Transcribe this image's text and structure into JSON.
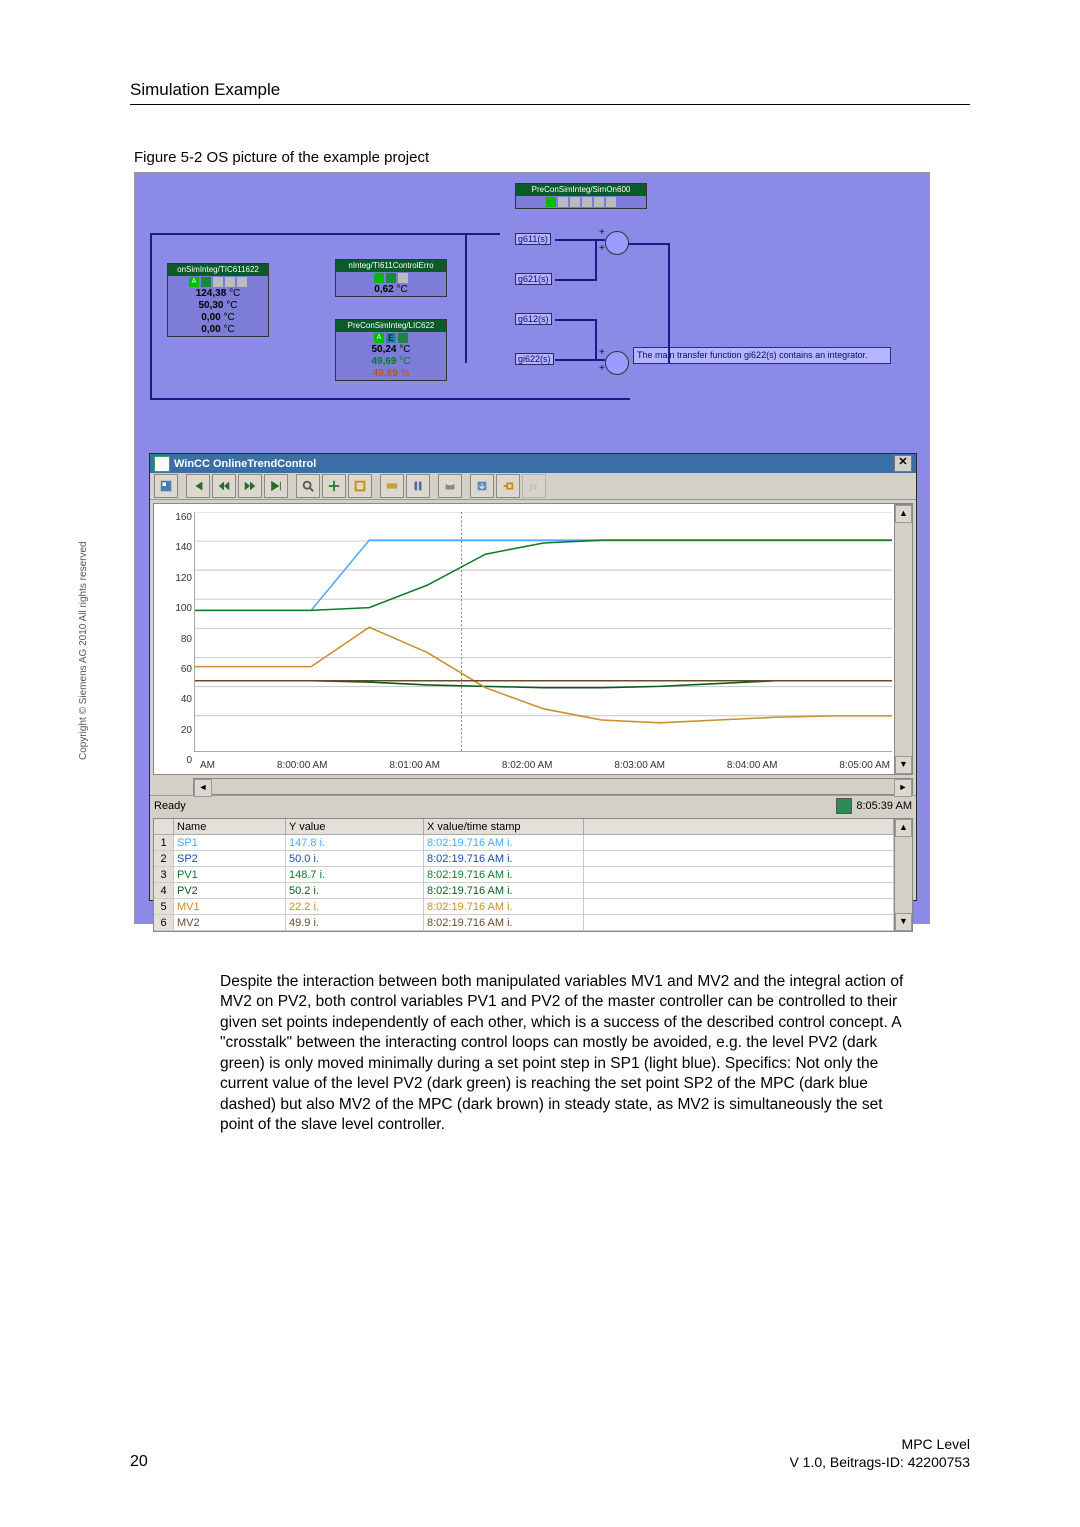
{
  "header": {
    "title": "Simulation Example"
  },
  "figure": {
    "caption": "Figure 5-2 OS picture of the example project"
  },
  "process": {
    "simon": {
      "title": "PreConSimInteg/SimOn600"
    },
    "tic": {
      "title": "onSimInteg/TIC611622",
      "v1": "124,38",
      "u1": "°C",
      "v2": "50,30",
      "u2": "°C",
      "v3": "0,00",
      "u3": "°C",
      "v4": "0,00",
      "u4": "°C"
    },
    "ctrlerr": {
      "title": "nInteg/TI611ControlErro",
      "v1": "0,62",
      "u1": "°C"
    },
    "lic": {
      "title": "PreConSimInteg/LIC622",
      "v1": "50,24",
      "u1": "°C",
      "v2": "49,69",
      "u2": "°C",
      "v3": "49,89",
      "u3": "%"
    },
    "tags": {
      "g611": "g611(s)",
      "g621": "g621(s)",
      "g612": "g612(s)",
      "gi622": "gi622(s)"
    },
    "note": "The main transfer function gi622(s) contains an integrator."
  },
  "trend": {
    "title": "WinCC OnlineTrendControl",
    "y_ticks": [
      "160",
      "140",
      "120",
      "100",
      "80",
      "60",
      "40",
      "20",
      "0"
    ],
    "x_ticks": [
      "AM",
      "8:00:00 AM",
      "8:01:00 AM",
      "8:02:00 AM",
      "8:03:00 AM",
      "8:04:00 AM",
      "8:05:00 AM"
    ],
    "status_left": "Ready",
    "status_time": "8:05:39 AM",
    "table": {
      "headers": [
        "",
        "Name",
        "Y value",
        "X value/time stamp"
      ],
      "rows": [
        {
          "idx": "1",
          "name": "SP1",
          "yv": "147.8 i.",
          "ts": "8:02:19.716 AM i.",
          "color": "#4aa8ff"
        },
        {
          "idx": "2",
          "name": "SP2",
          "yv": "50.0 i.",
          "ts": "8:02:19.716 AM i.",
          "color": "#1a4aa6"
        },
        {
          "idx": "3",
          "name": "PV1",
          "yv": "148.7 i.",
          "ts": "8:02:19.716 AM i.",
          "color": "#107a2a"
        },
        {
          "idx": "4",
          "name": "PV2",
          "yv": "50.2 i.",
          "ts": "8:02:19.716 AM i.",
          "color": "#0c5a1c"
        },
        {
          "idx": "5",
          "name": "MV1",
          "yv": "22.2 i.",
          "ts": "8:02:19.716 AM i.",
          "color": "#c88f2a"
        },
        {
          "idx": "6",
          "name": "MV2",
          "yv": "49.9 i.",
          "ts": "8:02:19.716 AM i.",
          "color": "#6a4a2a"
        }
      ]
    }
  },
  "chart_data": {
    "type": "line",
    "xlabel": "",
    "ylabel": "",
    "ylim": [
      0,
      170
    ],
    "x_ticks": [
      "8:00",
      "8:01",
      "8:02",
      "8:03",
      "8:04",
      "8:05"
    ],
    "series": [
      {
        "name": "SP1",
        "color": "#4aa8ff",
        "values": [
          100,
          100,
          100,
          150,
          150,
          150,
          150,
          150,
          150,
          150,
          150,
          150,
          150
        ]
      },
      {
        "name": "SP2",
        "color": "#1a4aa6",
        "values": [
          50,
          50,
          50,
          50,
          50,
          50,
          50,
          50,
          50,
          50,
          50,
          50,
          50
        ]
      },
      {
        "name": "PV1",
        "color": "#107a2a",
        "values": [
          100,
          100,
          100,
          102,
          118,
          140,
          148,
          150,
          150,
          150,
          150,
          150,
          150
        ]
      },
      {
        "name": "PV2",
        "color": "#0c5a1c",
        "values": [
          50,
          50,
          50,
          49,
          47,
          46,
          45,
          45,
          46,
          48,
          50,
          50,
          50
        ]
      },
      {
        "name": "MV1",
        "color": "#c88f2a",
        "values": [
          60,
          60,
          60,
          88,
          70,
          45,
          30,
          22,
          20,
          22,
          24,
          25,
          25
        ]
      },
      {
        "name": "MV2",
        "color": "#6a4a2a",
        "values": [
          50,
          50,
          50,
          50,
          50,
          50,
          50,
          50,
          50,
          50,
          50,
          50,
          50
        ]
      }
    ]
  },
  "body": {
    "para": "Despite the interaction between both manipulated variables MV1 and MV2 and the integral action of MV2 on PV2, both control variables PV1 and PV2 of the master controller can be controlled to their given set points independently of each other, which is a success of the described control concept. A \"crosstalk\" between the interacting control loops can mostly be avoided, e.g. the level PV2 (dark green) is only moved minimally during a set point step in SP1 (light blue). Specifics: Not only the current value of the level PV2 (dark green) is reaching the set point SP2 of the MPC (dark blue dashed) but also MV2 of the MPC (dark brown) in steady state, as MV2 is simultaneously the set point of the slave level controller."
  },
  "footer": {
    "page": "20",
    "r1": "MPC Level",
    "r2": "V 1.0, Beitrags-ID: 42200753"
  },
  "copyright": "Copyright © Siemens AG 2010 All rights reserved"
}
